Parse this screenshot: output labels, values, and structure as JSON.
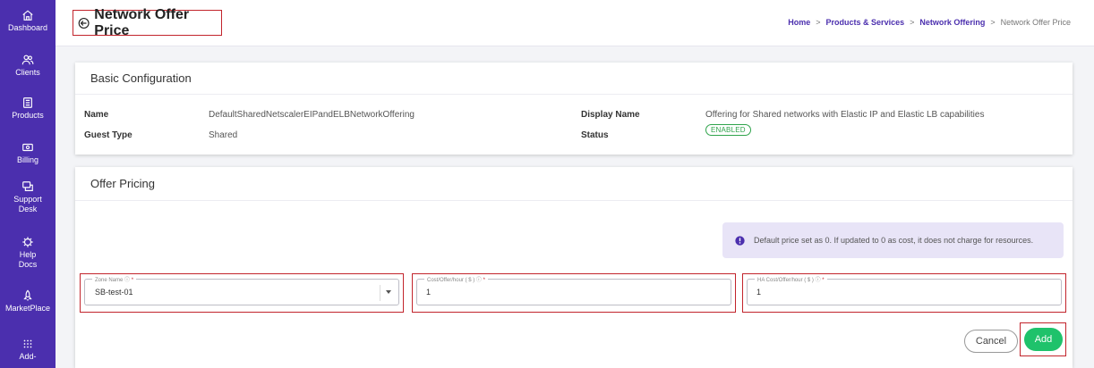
{
  "sidebar": {
    "items": [
      {
        "label": "Dashboard",
        "icon": "home-icon"
      },
      {
        "label": "Clients",
        "icon": "users-icon"
      },
      {
        "label": "Products",
        "icon": "products-icon"
      },
      {
        "label": "Billing",
        "icon": "billing-icon"
      },
      {
        "label": "Support Desk",
        "icon": "support-icon"
      },
      {
        "label": "Help Docs",
        "icon": "help-icon"
      },
      {
        "label": "MarketPlace",
        "icon": "rocket-icon"
      },
      {
        "label": "Add-",
        "icon": "grid-icon"
      }
    ]
  },
  "header": {
    "title": "Network Offer Price",
    "breadcrumb": [
      "Home",
      "Products & Services",
      "Network Offering",
      "Network Offer Price"
    ]
  },
  "basic_config": {
    "title": "Basic Configuration",
    "name_label": "Name",
    "name_value": "DefaultSharedNetscalerEIPandELBNetworkOffering",
    "guest_type_label": "Guest Type",
    "guest_type_value": "Shared",
    "display_name_label": "Display Name",
    "display_name_value": "Offering for Shared networks with Elastic IP and Elastic LB capabilities",
    "status_label": "Status",
    "status_value": "ENABLED"
  },
  "offer_pricing": {
    "title": "Offer Pricing",
    "info_text": "Default price set as 0. If updated to 0 as cost, it does not charge for resources.",
    "zone_name": {
      "label": "Zone Name",
      "value": "SB-test-01"
    },
    "cost": {
      "label": "Cost/Offer/hour ( $ )",
      "value": "1"
    },
    "ha_cost": {
      "label": "HA Cost/Offer/hour ( $ )",
      "value": "1"
    },
    "cancel_label": "Cancel",
    "add_label": "Add"
  },
  "colors": {
    "sidebar": "#4b2fae",
    "accent": "#4b2fae",
    "add_button": "#1fc26b",
    "highlight": "#c2242c",
    "enabled": "#2fa34b"
  }
}
